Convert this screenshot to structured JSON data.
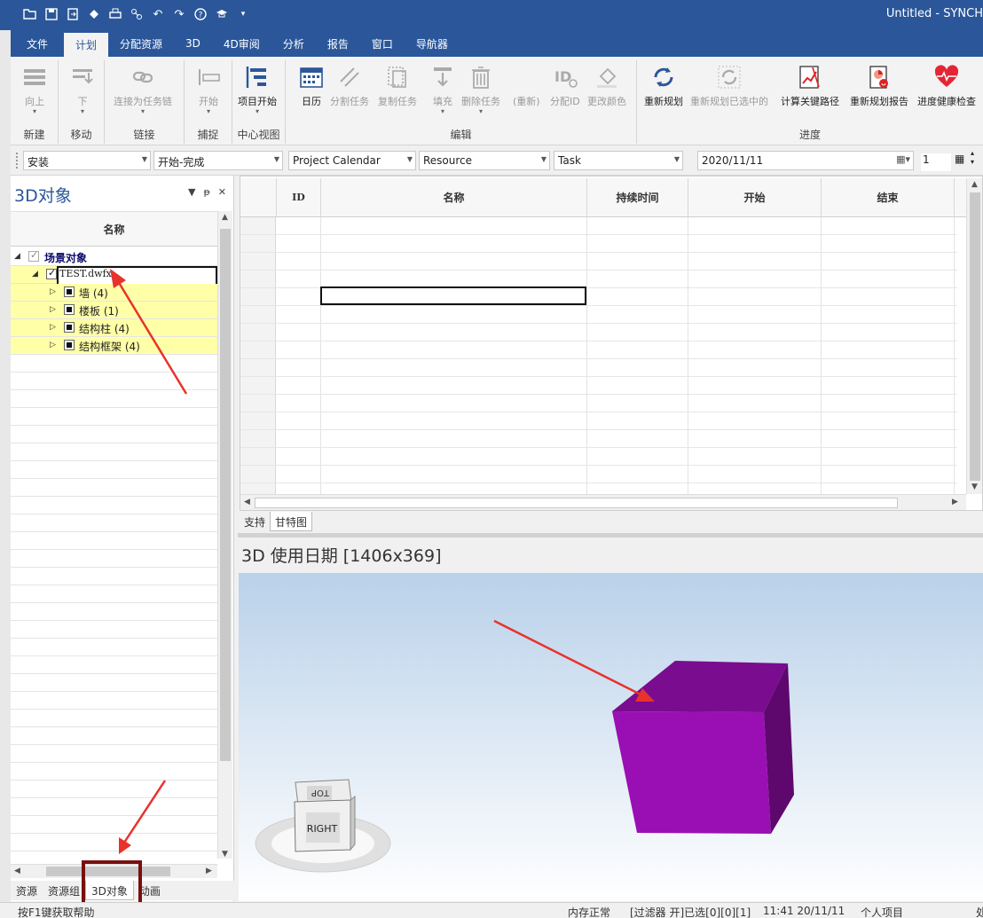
{
  "window": {
    "title": "Untitled - SYNCH"
  },
  "ribbon_tabs": [
    "文件",
    "计划",
    "分配资源",
    "3D",
    "4D审阅",
    "分析",
    "报告",
    "窗口",
    "导航器"
  ],
  "ribbon": {
    "up": "向上",
    "down": "下",
    "link": "连接为任务链",
    "start": "开始",
    "project_start": "项目开始",
    "calendar": "日历",
    "split": "分割任务",
    "copy": "复制任务",
    "fill": "填充",
    "delete": "删除任务",
    "renumber": "(重新)",
    "assign_id": "分配ID",
    "change_color": "更改颜色",
    "reschedule": "重新规划",
    "reschedule_selected": "重新规划已选中的",
    "critical_path": "计算关键路径",
    "reschedule_report": "重新规划报告",
    "health_check": "进度健康检查",
    "groups": {
      "new": "新建",
      "move": "移动",
      "link": "链接",
      "capture": "捕捉",
      "center_view": "中心视图",
      "edit": "编辑",
      "schedule": "进度"
    }
  },
  "filters": {
    "f1": "安装",
    "f2": "开始-完成",
    "f3": "Project Calendar",
    "f4": "Resource",
    "f5": "Task",
    "date": "2020/11/11",
    "spin": "1"
  },
  "left_panel": {
    "title": "3D对象",
    "col_name": "名称",
    "tree": {
      "root": "场景对象",
      "file": "TEST.dwfx",
      "items": [
        "墙 (4)",
        "楼板 (1)",
        "结构柱 (4)",
        "结构框架 (4)"
      ]
    },
    "bottom_tabs": [
      "资源",
      "资源组",
      "3D对象",
      "动画"
    ]
  },
  "gantt": {
    "columns": [
      "ID",
      "名称",
      "持续时间",
      "开始",
      "结束"
    ],
    "tabs": [
      "支持",
      "甘特图"
    ]
  },
  "viewport": {
    "title": "3D 使用日期  [1406x369]",
    "cube_face": "RIGHT",
    "cube_top": "TOP",
    "box_color": "#9a0fb3"
  },
  "status": {
    "help": "按F1键获取帮助",
    "memory": "内存正常",
    "filter": "[过滤器 开]已选[0][0][1]",
    "time": "11:41 20/11/11",
    "project": "个人项目",
    "extra": "处"
  }
}
